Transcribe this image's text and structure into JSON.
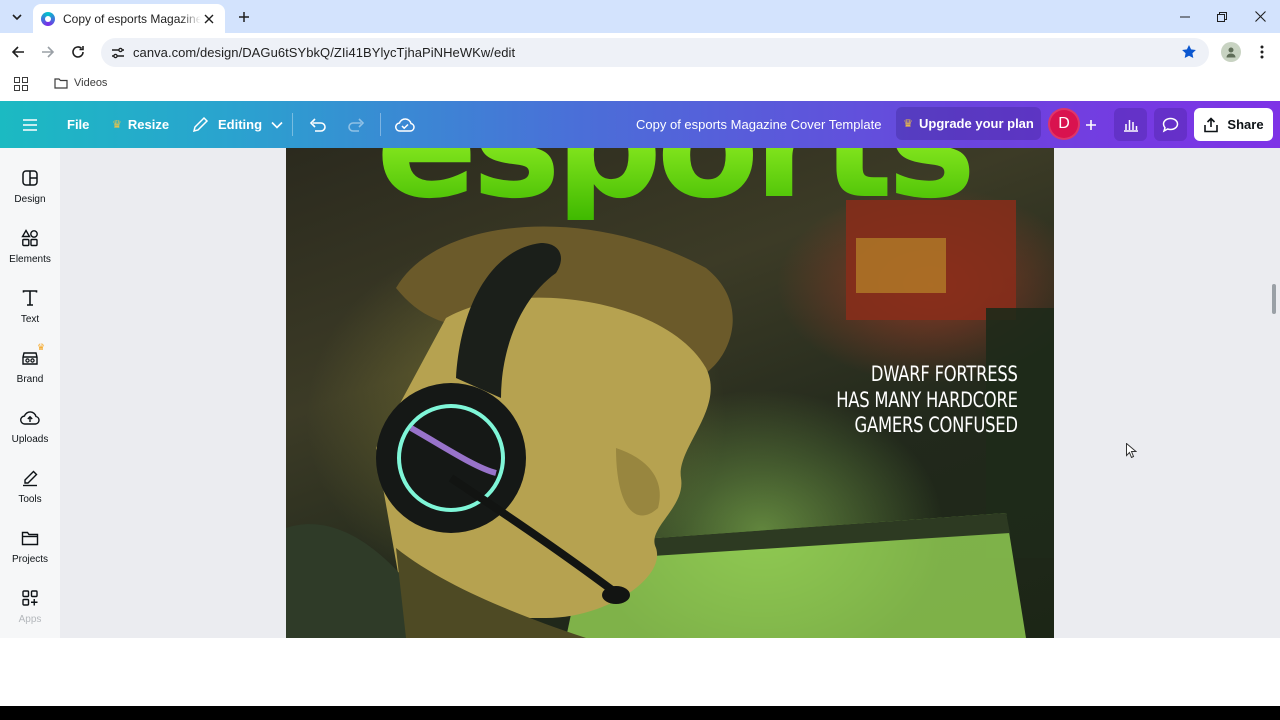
{
  "browser": {
    "tab_title": "Copy of esports Magazine Cover Template - Poster",
    "url": "canva.com/design/DAGu6tSYbkQ/ZIi41BYlycTjhaPiNHeWKw/edit",
    "bookmark_folder": "Videos"
  },
  "header": {
    "file_label": "File",
    "resize_label": "Resize",
    "editing_label": "Editing",
    "document_title": "Copy of esports Magazine Cover Template",
    "upgrade_label": "Upgrade your plan",
    "avatar_initial": "D",
    "share_label": "Share"
  },
  "sidebar": {
    "items": [
      {
        "label": "Design",
        "icon": "design-icon"
      },
      {
        "label": "Elements",
        "icon": "elements-icon"
      },
      {
        "label": "Text",
        "icon": "text-icon"
      },
      {
        "label": "Brand",
        "icon": "brand-icon"
      },
      {
        "label": "Uploads",
        "icon": "uploads-icon"
      },
      {
        "label": "Tools",
        "icon": "tools-icon"
      },
      {
        "label": "Projects",
        "icon": "projects-icon"
      },
      {
        "label": "Apps",
        "icon": "apps-icon"
      }
    ]
  },
  "design": {
    "magazine_title": "esports",
    "headline_lines": [
      "DWARF FORTRESS",
      "HAS MANY HARDCORE",
      "GAMERS CONFUSED"
    ]
  },
  "colors": {
    "header_gradient_start": "#1bbac2",
    "header_gradient_end": "#7e33e6",
    "avatar_bg": "#d9124f",
    "title_green": "#7be01a"
  }
}
